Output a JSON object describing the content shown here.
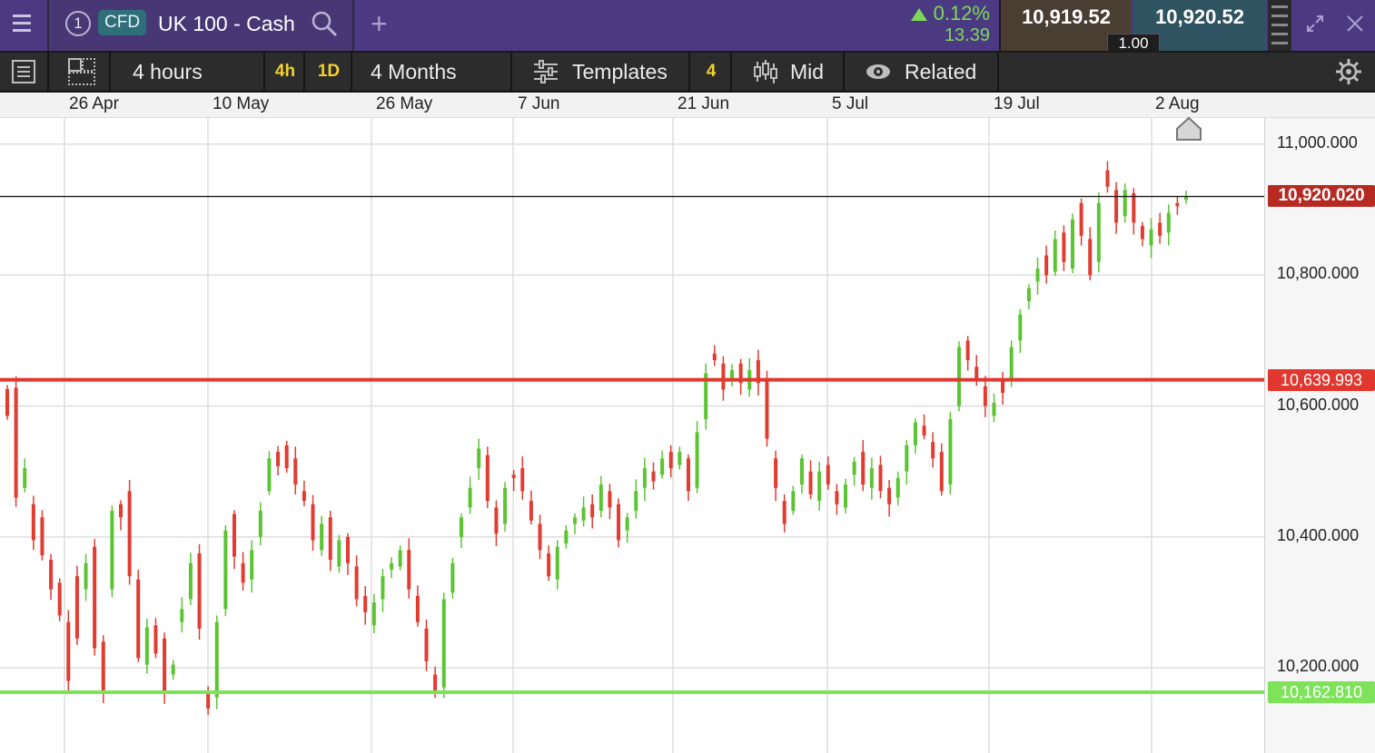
{
  "header": {
    "instrument_number": "1",
    "instrument_tag": "CFD",
    "instrument_name": "UK 100 - Cash",
    "change_percent": "0.12%",
    "change_abs": "13.39",
    "sell_price": "10,919.52",
    "buy_price": "10,920.52",
    "spread": "1.00",
    "colors": {
      "bar": "#4b3a82",
      "up": "#7ed957",
      "sell_bg": "#4a3d31",
      "buy_bg": "#2f5360"
    }
  },
  "toolbar": {
    "interval": "4 hours",
    "interval_short_a": "4h",
    "interval_short_b": "1D",
    "range": "4 Months",
    "templates": "Templates",
    "indicator_count": "4",
    "price_type": "Mid",
    "related": "Related"
  },
  "chart_data": {
    "type": "candlestick",
    "x_ticks": [
      "26 Apr",
      "10 May",
      "26 May",
      "7 Jun",
      "21 Jun",
      "5 Jul",
      "19 Jul",
      "2 Aug"
    ],
    "y_ticks": [
      "11,000.000",
      "10,800.000",
      "10,600.000",
      "10,400.000",
      "10,200.000"
    ],
    "y_tick_values": [
      11000,
      10800,
      10600,
      10400,
      10200
    ],
    "ylim": [
      10070,
      11040
    ],
    "current_price_label": "10,920.020",
    "current_price": 10920.02,
    "resistance_label": "10,639.993",
    "resistance": 10639.993,
    "support_label": "10,162.810",
    "support": 10162.81,
    "colors": {
      "up": "#5cc433",
      "down": "#e23b30",
      "resistance": "#e0382e",
      "support": "#7ee35a",
      "current": "#b72a22"
    },
    "path": [
      [
        10626,
        10585
      ],
      [
        10628,
        10460
      ],
      [
        10475,
        10505
      ],
      [
        10450,
        10395
      ],
      [
        10430,
        10372
      ],
      [
        10365,
        10320
      ],
      [
        10330,
        10280
      ],
      [
        10270,
        10180
      ],
      [
        10340,
        10245
      ],
      [
        10320,
        10360
      ],
      [
        10385,
        10230
      ],
      [
        10240,
        10165
      ],
      [
        10320,
        10440
      ],
      [
        10450,
        10430
      ],
      [
        10470,
        10340
      ],
      [
        10335,
        10215
      ],
      [
        10205,
        10262
      ],
      [
        10265,
        10222
      ],
      [
        10245,
        10160
      ],
      [
        10190,
        10205
      ],
      [
        10270,
        10290
      ],
      [
        10305,
        10360
      ],
      [
        10375,
        10260
      ],
      [
        10160,
        10138
      ],
      [
        10155,
        10270
      ],
      [
        10290,
        10410
      ],
      [
        10435,
        10370
      ],
      [
        10360,
        10330
      ],
      [
        10335,
        10380
      ],
      [
        10400,
        10440
      ],
      [
        10470,
        10520
      ],
      [
        10530,
        10508
      ],
      [
        10540,
        10505
      ],
      [
        10520,
        10480
      ],
      [
        10470,
        10455
      ],
      [
        10450,
        10395
      ],
      [
        10380,
        10420
      ],
      [
        10430,
        10365
      ],
      [
        10355,
        10395
      ],
      [
        10400,
        10360
      ],
      [
        10355,
        10305
      ],
      [
        10310,
        10285
      ],
      [
        10265,
        10300
      ],
      [
        10305,
        10340
      ],
      [
        10350,
        10360
      ],
      [
        10355,
        10380
      ],
      [
        10380,
        10320
      ],
      [
        10310,
        10270
      ],
      [
        10260,
        10210
      ],
      [
        10190,
        10162
      ],
      [
        10170,
        10305
      ],
      [
        10315,
        10360
      ],
      [
        10400,
        10430
      ],
      [
        10445,
        10475
      ],
      [
        10505,
        10535
      ],
      [
        10525,
        10455
      ],
      [
        10445,
        10405
      ],
      [
        10420,
        10475
      ],
      [
        10495,
        10490
      ],
      [
        10505,
        10470
      ],
      [
        10455,
        10425
      ],
      [
        10420,
        10380
      ],
      [
        10375,
        10340
      ],
      [
        10335,
        10385
      ],
      [
        10390,
        10410
      ],
      [
        10420,
        10430
      ],
      [
        10425,
        10445
      ],
      [
        10450,
        10430
      ],
      [
        10440,
        10480
      ],
      [
        10470,
        10445
      ],
      [
        10450,
        10395
      ],
      [
        10410,
        10430
      ],
      [
        10440,
        10470
      ],
      [
        10475,
        10505
      ],
      [
        10500,
        10485
      ],
      [
        10495,
        10520
      ],
      [
        10530,
        10505
      ],
      [
        10510,
        10530
      ],
      [
        10520,
        10470
      ],
      [
        10475,
        10560
      ],
      [
        10580,
        10650
      ],
      [
        10680,
        10670
      ],
      [
        10665,
        10625
      ],
      [
        10640,
        10655
      ],
      [
        10665,
        10635
      ],
      [
        10625,
        10655
      ],
      [
        10670,
        10635
      ],
      [
        10640,
        10550
      ],
      [
        10520,
        10475
      ],
      [
        10455,
        10420
      ],
      [
        10440,
        10470
      ],
      [
        10480,
        10520
      ],
      [
        10500,
        10465
      ],
      [
        10455,
        10500
      ],
      [
        10510,
        10480
      ],
      [
        10470,
        10450
      ],
      [
        10445,
        10480
      ],
      [
        10495,
        10515
      ],
      [
        10530,
        10480
      ],
      [
        10475,
        10505
      ],
      [
        10510,
        10470
      ],
      [
        10475,
        10450
      ],
      [
        10460,
        10490
      ],
      [
        10500,
        10540
      ],
      [
        10540,
        10575
      ],
      [
        10570,
        10555
      ],
      [
        10545,
        10520
      ],
      [
        10530,
        10470
      ],
      [
        10480,
        10580
      ],
      [
        10600,
        10690
      ],
      [
        10700,
        10670
      ],
      [
        10660,
        10640
      ],
      [
        10630,
        10600
      ],
      [
        10585,
        10605
      ],
      [
        10640,
        10620
      ],
      [
        10640,
        10690
      ],
      [
        10700,
        10740
      ],
      [
        10760,
        10780
      ],
      [
        10790,
        10810
      ],
      [
        10830,
        10800
      ],
      [
        10805,
        10855
      ],
      [
        10865,
        10820
      ],
      [
        10810,
        10885
      ],
      [
        10910,
        10860
      ],
      [
        10855,
        10800
      ],
      [
        10820,
        10910
      ],
      [
        10960,
        10935
      ],
      [
        10930,
        10880
      ],
      [
        10890,
        10930
      ],
      [
        10925,
        10880
      ],
      [
        10875,
        10855
      ],
      [
        10845,
        10870
      ],
      [
        10880,
        10860
      ],
      [
        10865,
        10895
      ],
      [
        10910,
        10905
      ],
      [
        10915,
        10920
      ]
    ]
  },
  "icons": {
    "menu": "menu-icon",
    "search": "search-icon",
    "add": "plus-icon",
    "expand": "expand-icon",
    "close": "close-icon",
    "list": "list-icon",
    "layout": "layout-icon",
    "templates": "sliders-icon",
    "mid": "candles-icon",
    "related": "eye-icon",
    "settings": "gear-icon",
    "scroll": "home-arrow-icon"
  }
}
